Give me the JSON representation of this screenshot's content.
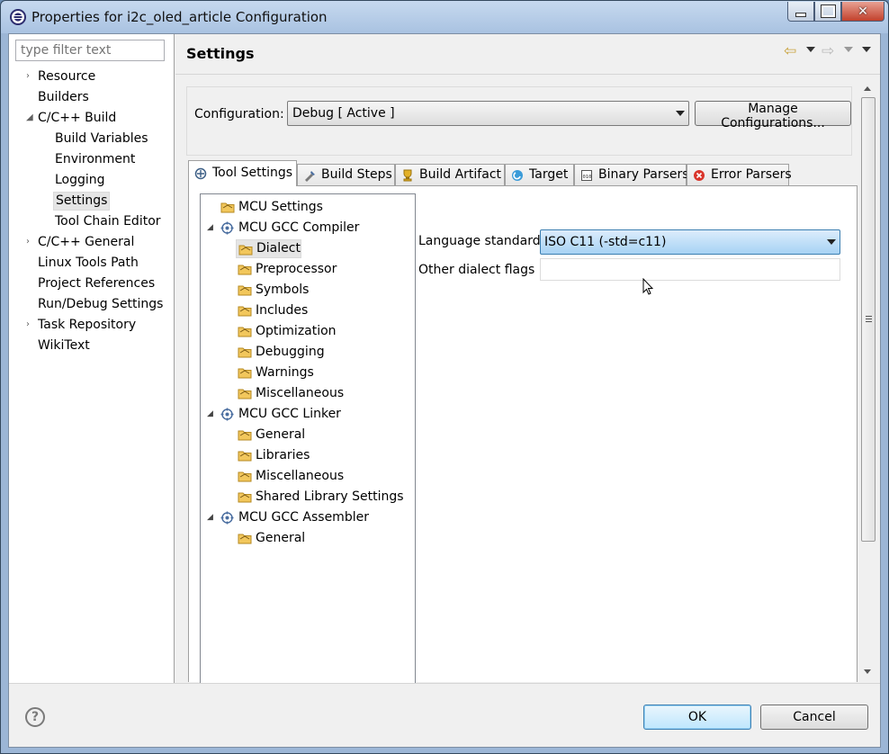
{
  "window": {
    "title": "Properties for i2c_oled_article Configuration"
  },
  "sidebar": {
    "filter_placeholder": "type filter text",
    "items": [
      {
        "label": "Resource",
        "expander": "›"
      },
      {
        "label": "Builders",
        "expander": ""
      },
      {
        "label": "C/C++ Build",
        "expander": "◢"
      },
      {
        "label": "Build Variables",
        "expander": ""
      },
      {
        "label": "Environment",
        "expander": ""
      },
      {
        "label": "Logging",
        "expander": ""
      },
      {
        "label": "Settings",
        "expander": "",
        "selected": true
      },
      {
        "label": "Tool Chain Editor",
        "expander": ""
      },
      {
        "label": "C/C++ General",
        "expander": "›"
      },
      {
        "label": "Linux Tools Path",
        "expander": ""
      },
      {
        "label": "Project References",
        "expander": ""
      },
      {
        "label": "Run/Debug Settings",
        "expander": ""
      },
      {
        "label": "Task Repository",
        "expander": "›"
      },
      {
        "label": "WikiText",
        "expander": ""
      }
    ]
  },
  "header": {
    "title": "Settings",
    "back_icon": "back-arrow-icon",
    "forward_icon": "forward-arrow-icon"
  },
  "configuration": {
    "label": "Configuration:",
    "value": "Debug  [ Active ]",
    "manage_button": "Manage Configurations..."
  },
  "tabs": [
    {
      "label": "Tool Settings",
      "icon": "tool-settings-icon",
      "active": true
    },
    {
      "label": "Build Steps",
      "icon": "build-steps-icon"
    },
    {
      "label": "Build Artifact",
      "icon": "build-artifact-icon"
    },
    {
      "label": "Target",
      "icon": "target-icon"
    },
    {
      "label": "Binary Parsers",
      "icon": "binary-parsers-icon"
    },
    {
      "label": "Error Parsers",
      "icon": "error-parsers-icon"
    }
  ],
  "tool_tree": [
    {
      "label": "MCU Settings",
      "type": "folder"
    },
    {
      "label": "MCU GCC Compiler",
      "type": "gear",
      "expander": "◢"
    },
    {
      "label": "Dialect",
      "type": "folder",
      "selected": true
    },
    {
      "label": "Preprocessor",
      "type": "folder"
    },
    {
      "label": "Symbols",
      "type": "folder"
    },
    {
      "label": "Includes",
      "type": "folder"
    },
    {
      "label": "Optimization",
      "type": "folder"
    },
    {
      "label": "Debugging",
      "type": "folder"
    },
    {
      "label": "Warnings",
      "type": "folder"
    },
    {
      "label": "Miscellaneous",
      "type": "folder"
    },
    {
      "label": "MCU GCC Linker",
      "type": "gear",
      "expander": "◢"
    },
    {
      "label": "General",
      "type": "folder"
    },
    {
      "label": "Libraries",
      "type": "folder"
    },
    {
      "label": "Miscellaneous",
      "type": "folder"
    },
    {
      "label": "Shared Library Settings",
      "type": "folder"
    },
    {
      "label": "MCU GCC Assembler",
      "type": "gear",
      "expander": "◢"
    },
    {
      "label": "General",
      "type": "folder"
    }
  ],
  "dialect": {
    "language_label": "Language standard",
    "language_value": "ISO C11 (-std=c11)",
    "other_flags_label": "Other dialect flags",
    "other_flags_value": ""
  },
  "footer": {
    "help": "?",
    "ok": "OK",
    "cancel": "Cancel"
  },
  "colors": {
    "accent": "#3c7fb1",
    "selection": "#e5e5e5",
    "combo_highlight": "#a7d3f4"
  }
}
